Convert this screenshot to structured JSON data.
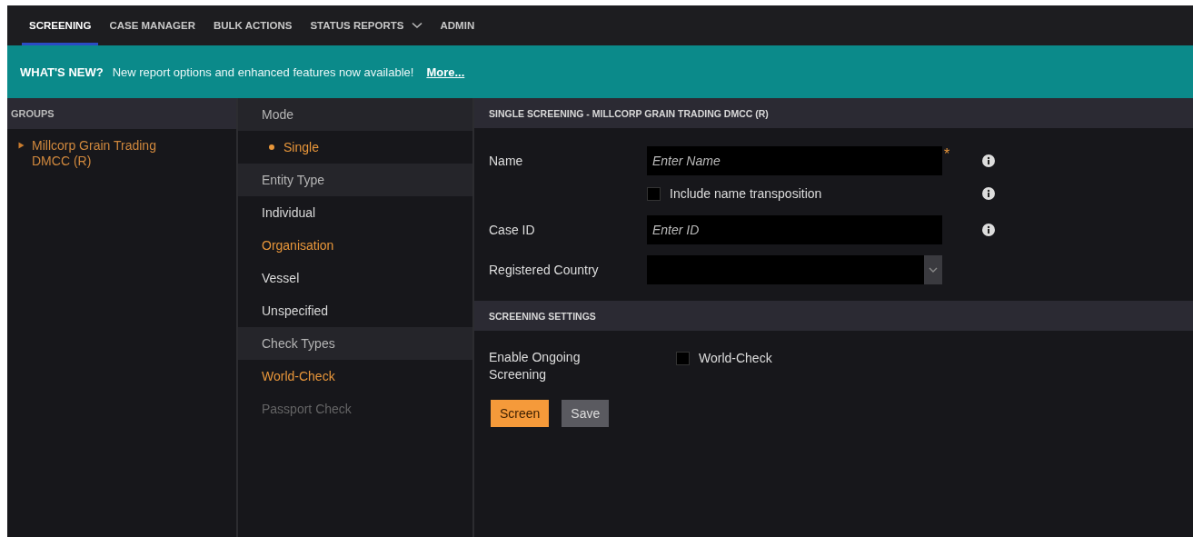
{
  "nav": {
    "tabs": [
      {
        "label": "SCREENING",
        "selected": true,
        "dropdown": false
      },
      {
        "label": "CASE MANAGER",
        "selected": false,
        "dropdown": false
      },
      {
        "label": "BULK ACTIONS",
        "selected": false,
        "dropdown": false
      },
      {
        "label": "STATUS REPORTS",
        "selected": false,
        "dropdown": true
      },
      {
        "label": "ADMIN",
        "selected": false,
        "dropdown": false
      }
    ]
  },
  "banner": {
    "heading": "WHAT'S NEW?",
    "message": "New report options and enhanced features now available!",
    "link": "More..."
  },
  "groups": {
    "title": "GROUPS",
    "items": [
      {
        "label": "Millcorp Grain Trading DMCC (R)",
        "selected": true,
        "expanded": false
      }
    ]
  },
  "options": {
    "sections": [
      {
        "title": "Mode",
        "items": [
          {
            "label": "Single",
            "kind": "dot",
            "selected": true,
            "disabled": false
          }
        ]
      },
      {
        "title": "Entity Type",
        "items": [
          {
            "label": "Individual",
            "kind": "text",
            "selected": false,
            "disabled": false
          },
          {
            "label": "Organisation",
            "kind": "text",
            "selected": true,
            "disabled": false
          },
          {
            "label": "Vessel",
            "kind": "text",
            "selected": false,
            "disabled": false
          },
          {
            "label": "Unspecified",
            "kind": "text",
            "selected": false,
            "disabled": false
          }
        ]
      },
      {
        "title": "Check Types",
        "items": [
          {
            "label": "World-Check",
            "kind": "text",
            "selected": true,
            "disabled": false
          },
          {
            "label": "Passport Check",
            "kind": "text",
            "selected": false,
            "disabled": true
          }
        ]
      }
    ]
  },
  "form": {
    "title": "SINGLE SCREENING - MILLCORP GRAIN TRADING DMCC (R)",
    "fields": [
      {
        "kind": "text",
        "label": "Name",
        "placeholder": "Enter Name",
        "required_marker": "*",
        "info": true
      },
      {
        "kind": "checkbox",
        "label": "Include name transposition",
        "checked": false,
        "info": true
      },
      {
        "kind": "text",
        "label": "Case ID",
        "placeholder": "Enter ID",
        "info": true
      },
      {
        "kind": "select",
        "label": "Registered Country",
        "info": false
      }
    ]
  },
  "settings": {
    "title": "SCREENING SETTINGS",
    "label": "Enable Ongoing Screening",
    "options": [
      {
        "label": "World-Check",
        "checked": false
      }
    ]
  },
  "buttons": [
    {
      "label": "Screen",
      "kind": "primary"
    },
    {
      "label": "Save",
      "kind": "secondary"
    }
  ]
}
